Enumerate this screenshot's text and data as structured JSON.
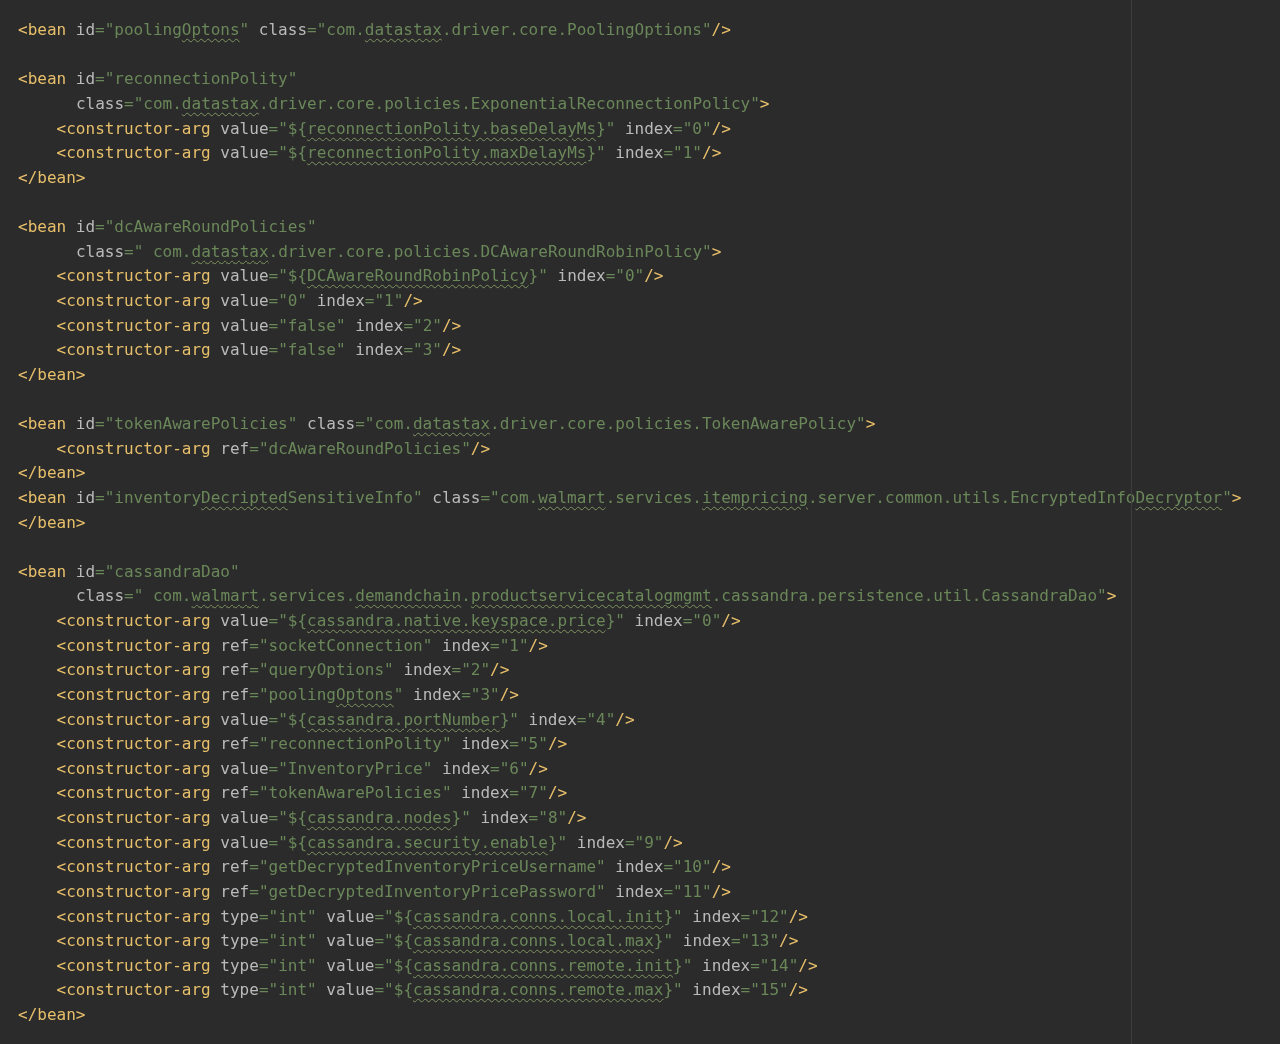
{
  "editor": {
    "lines": [
      {
        "kind": "tag",
        "tokens": [
          {
            "kind": "tag",
            "text": "<bean"
          },
          {
            "kind": "attr",
            "text": " id"
          },
          {
            "kind": "str",
            "text": "=\"pooling"
          },
          {
            "kind": "typo",
            "text": "Optons"
          },
          {
            "kind": "str",
            "text": "\""
          },
          {
            "kind": "attr",
            "text": " class"
          },
          {
            "kind": "str",
            "text": "=\"com."
          },
          {
            "kind": "typo",
            "text": "datastax"
          },
          {
            "kind": "str",
            "text": ".driver.core.PoolingOptions\""
          },
          {
            "kind": "tag",
            "text": "/>"
          }
        ]
      },
      {
        "kind": "blank"
      },
      {
        "kind": "tag",
        "tokens": [
          {
            "kind": "tag",
            "text": "<bean"
          },
          {
            "kind": "attr",
            "text": " id"
          },
          {
            "kind": "str",
            "text": "=\"reconnectionPolity\""
          }
        ]
      },
      {
        "kind": "cont",
        "tokens": [
          {
            "kind": "attr",
            "text": "class"
          },
          {
            "kind": "str",
            "text": "=\"com."
          },
          {
            "kind": "typo",
            "text": "datastax"
          },
          {
            "kind": "str",
            "text": ".driver.core.policies.ExponentialReconnectionPolicy\""
          },
          {
            "kind": "tag",
            "text": ">"
          }
        ]
      },
      {
        "kind": "arg",
        "tokens": [
          {
            "kind": "tag",
            "text": "<constructor-arg"
          },
          {
            "kind": "attr",
            "text": " value"
          },
          {
            "kind": "str",
            "text": "=\"${"
          },
          {
            "kind": "typo",
            "text": "reconnectionPolity.baseDelayMs"
          },
          {
            "kind": "str",
            "text": "}\""
          },
          {
            "kind": "attr",
            "text": " index"
          },
          {
            "kind": "str",
            "text": "=\"0\""
          },
          {
            "kind": "tag",
            "text": "/>"
          }
        ]
      },
      {
        "kind": "arg",
        "tokens": [
          {
            "kind": "tag",
            "text": "<constructor-arg"
          },
          {
            "kind": "attr",
            "text": " value"
          },
          {
            "kind": "str",
            "text": "=\"${"
          },
          {
            "kind": "typo",
            "text": "reconnectionPolity.maxDelayMs"
          },
          {
            "kind": "str",
            "text": "}\""
          },
          {
            "kind": "attr",
            "text": " index"
          },
          {
            "kind": "str",
            "text": "=\"1\""
          },
          {
            "kind": "tag",
            "text": "/>"
          }
        ]
      },
      {
        "kind": "tag",
        "tokens": [
          {
            "kind": "tag",
            "text": "</bean>"
          }
        ]
      },
      {
        "kind": "blank"
      },
      {
        "kind": "tag",
        "tokens": [
          {
            "kind": "tag",
            "text": "<bean"
          },
          {
            "kind": "attr",
            "text": " id"
          },
          {
            "kind": "str",
            "text": "=\"dcAwareRoundPolicies\""
          }
        ]
      },
      {
        "kind": "cont",
        "tokens": [
          {
            "kind": "attr",
            "text": "class"
          },
          {
            "kind": "str",
            "text": "=\" com."
          },
          {
            "kind": "typo",
            "text": "datastax"
          },
          {
            "kind": "str",
            "text": ".driver.core.policies.DCAwareRoundRobinPolicy\""
          },
          {
            "kind": "tag",
            "text": ">"
          }
        ]
      },
      {
        "kind": "arg",
        "tokens": [
          {
            "kind": "tag",
            "text": "<constructor-arg"
          },
          {
            "kind": "attr",
            "text": " value"
          },
          {
            "kind": "str",
            "text": "=\"${"
          },
          {
            "kind": "typo",
            "text": "DCAwareRoundRobinPolicy"
          },
          {
            "kind": "str",
            "text": "}\""
          },
          {
            "kind": "attr",
            "text": " index"
          },
          {
            "kind": "str",
            "text": "=\"0\""
          },
          {
            "kind": "tag",
            "text": "/>"
          }
        ]
      },
      {
        "kind": "arg",
        "tokens": [
          {
            "kind": "tag",
            "text": "<constructor-arg"
          },
          {
            "kind": "attr",
            "text": " value"
          },
          {
            "kind": "str",
            "text": "=\"0\""
          },
          {
            "kind": "attr",
            "text": " index"
          },
          {
            "kind": "str",
            "text": "=\"1\""
          },
          {
            "kind": "tag",
            "text": "/>"
          }
        ]
      },
      {
        "kind": "arg",
        "tokens": [
          {
            "kind": "tag",
            "text": "<constructor-arg"
          },
          {
            "kind": "attr",
            "text": " value"
          },
          {
            "kind": "str",
            "text": "=\"false\""
          },
          {
            "kind": "attr",
            "text": " index"
          },
          {
            "kind": "str",
            "text": "=\"2\""
          },
          {
            "kind": "tag",
            "text": "/>"
          }
        ]
      },
      {
        "kind": "arg",
        "tokens": [
          {
            "kind": "tag",
            "text": "<constructor-arg"
          },
          {
            "kind": "attr",
            "text": " value"
          },
          {
            "kind": "str",
            "text": "=\"false\""
          },
          {
            "kind": "attr",
            "text": " index"
          },
          {
            "kind": "str",
            "text": "=\"3\""
          },
          {
            "kind": "tag",
            "text": "/>"
          }
        ]
      },
      {
        "kind": "tag",
        "tokens": [
          {
            "kind": "tag",
            "text": "</bean>"
          }
        ]
      },
      {
        "kind": "blank"
      },
      {
        "kind": "tag",
        "tokens": [
          {
            "kind": "tag",
            "text": "<bean"
          },
          {
            "kind": "attr",
            "text": " id"
          },
          {
            "kind": "str",
            "text": "=\"tokenAwarePolicies\""
          },
          {
            "kind": "attr",
            "text": " class"
          },
          {
            "kind": "str",
            "text": "=\"com."
          },
          {
            "kind": "typo",
            "text": "datastax"
          },
          {
            "kind": "str",
            "text": ".driver.core.policies.TokenAwarePolicy\""
          },
          {
            "kind": "tag",
            "text": ">"
          }
        ]
      },
      {
        "kind": "arg",
        "tokens": [
          {
            "kind": "tag",
            "text": "<constructor-arg"
          },
          {
            "kind": "attr",
            "text": " ref"
          },
          {
            "kind": "str",
            "text": "=\"dcAwareRoundPolicies\""
          },
          {
            "kind": "tag",
            "text": "/>"
          }
        ]
      },
      {
        "kind": "tag",
        "tokens": [
          {
            "kind": "tag",
            "text": "</bean>"
          }
        ]
      },
      {
        "kind": "tag",
        "tokens": [
          {
            "kind": "tag",
            "text": "<bean"
          },
          {
            "kind": "attr",
            "text": " id"
          },
          {
            "kind": "str",
            "text": "=\"inventory"
          },
          {
            "kind": "typo",
            "text": "Decripted"
          },
          {
            "kind": "str",
            "text": "SensitiveInfo\""
          },
          {
            "kind": "attr",
            "text": " class"
          },
          {
            "kind": "str",
            "text": "=\"com."
          },
          {
            "kind": "typo",
            "text": "walmart"
          },
          {
            "kind": "str",
            "text": ".services."
          },
          {
            "kind": "typo",
            "text": "itempricing"
          },
          {
            "kind": "str",
            "text": ".server.common.utils.EncryptedInfo"
          },
          {
            "kind": "typo",
            "text": "Decryptor"
          },
          {
            "kind": "str",
            "text": "\""
          },
          {
            "kind": "tag",
            "text": ">"
          }
        ]
      },
      {
        "kind": "tag",
        "tokens": [
          {
            "kind": "tag",
            "text": "</bean>"
          }
        ]
      },
      {
        "kind": "blank"
      },
      {
        "kind": "tag",
        "tokens": [
          {
            "kind": "tag",
            "text": "<bean"
          },
          {
            "kind": "attr",
            "text": " id"
          },
          {
            "kind": "str",
            "text": "=\"cassandraDao\""
          }
        ]
      },
      {
        "kind": "cont",
        "tokens": [
          {
            "kind": "attr",
            "text": "class"
          },
          {
            "kind": "str",
            "text": "=\" com."
          },
          {
            "kind": "typo",
            "text": "walmart"
          },
          {
            "kind": "str",
            "text": ".services."
          },
          {
            "kind": "typo",
            "text": "demandchain"
          },
          {
            "kind": "str",
            "text": "."
          },
          {
            "kind": "typo",
            "text": "productservicecatalogmgmt"
          },
          {
            "kind": "str",
            "text": ".cassandra.persistence.util.CassandraDao\""
          },
          {
            "kind": "tag",
            "text": ">"
          }
        ]
      },
      {
        "kind": "arg",
        "tokens": [
          {
            "kind": "tag",
            "text": "<constructor-arg"
          },
          {
            "kind": "attr",
            "text": " value"
          },
          {
            "kind": "str",
            "text": "=\"${"
          },
          {
            "kind": "typo",
            "text": "cassandra.native.keyspace.price"
          },
          {
            "kind": "str",
            "text": "}\""
          },
          {
            "kind": "attr",
            "text": " index"
          },
          {
            "kind": "str",
            "text": "=\"0\""
          },
          {
            "kind": "tag",
            "text": "/>"
          }
        ]
      },
      {
        "kind": "arg",
        "tokens": [
          {
            "kind": "tag",
            "text": "<constructor-arg"
          },
          {
            "kind": "attr",
            "text": " ref"
          },
          {
            "kind": "str",
            "text": "=\"socketConnection\""
          },
          {
            "kind": "attr",
            "text": " index"
          },
          {
            "kind": "str",
            "text": "=\"1\""
          },
          {
            "kind": "tag",
            "text": "/>"
          }
        ]
      },
      {
        "kind": "arg",
        "tokens": [
          {
            "kind": "tag",
            "text": "<constructor-arg"
          },
          {
            "kind": "attr",
            "text": " ref"
          },
          {
            "kind": "str",
            "text": "=\"queryOptions\""
          },
          {
            "kind": "attr",
            "text": " index"
          },
          {
            "kind": "str",
            "text": "=\"2\""
          },
          {
            "kind": "tag",
            "text": "/>"
          }
        ]
      },
      {
        "kind": "arg",
        "tokens": [
          {
            "kind": "tag",
            "text": "<constructor-arg"
          },
          {
            "kind": "attr",
            "text": " ref"
          },
          {
            "kind": "str",
            "text": "=\"pooling"
          },
          {
            "kind": "typo",
            "text": "Optons"
          },
          {
            "kind": "str",
            "text": "\""
          },
          {
            "kind": "attr",
            "text": " index"
          },
          {
            "kind": "str",
            "text": "=\"3\""
          },
          {
            "kind": "tag",
            "text": "/>"
          }
        ]
      },
      {
        "kind": "arg",
        "tokens": [
          {
            "kind": "tag",
            "text": "<constructor-arg"
          },
          {
            "kind": "attr",
            "text": " value"
          },
          {
            "kind": "str",
            "text": "=\"${"
          },
          {
            "kind": "typo",
            "text": "cassandra.portNumber"
          },
          {
            "kind": "str",
            "text": "}\""
          },
          {
            "kind": "attr",
            "text": " index"
          },
          {
            "kind": "str",
            "text": "=\"4\""
          },
          {
            "kind": "tag",
            "text": "/>"
          }
        ]
      },
      {
        "kind": "arg",
        "tokens": [
          {
            "kind": "tag",
            "text": "<constructor-arg"
          },
          {
            "kind": "attr",
            "text": " ref"
          },
          {
            "kind": "str",
            "text": "=\"reconnectionPolity\""
          },
          {
            "kind": "attr",
            "text": " index"
          },
          {
            "kind": "str",
            "text": "=\"5\""
          },
          {
            "kind": "tag",
            "text": "/>"
          }
        ]
      },
      {
        "kind": "arg",
        "tokens": [
          {
            "kind": "tag",
            "text": "<constructor-arg"
          },
          {
            "kind": "attr",
            "text": " value"
          },
          {
            "kind": "str",
            "text": "=\"InventoryPrice\""
          },
          {
            "kind": "attr",
            "text": " index"
          },
          {
            "kind": "str",
            "text": "=\"6\""
          },
          {
            "kind": "tag",
            "text": "/>"
          }
        ]
      },
      {
        "kind": "arg",
        "tokens": [
          {
            "kind": "tag",
            "text": "<constructor-arg"
          },
          {
            "kind": "attr",
            "text": " ref"
          },
          {
            "kind": "str",
            "text": "=\"tokenAwarePolicies\""
          },
          {
            "kind": "attr",
            "text": " index"
          },
          {
            "kind": "str",
            "text": "=\"7\""
          },
          {
            "kind": "tag",
            "text": "/>"
          }
        ]
      },
      {
        "kind": "arg",
        "tokens": [
          {
            "kind": "tag",
            "text": "<constructor-arg"
          },
          {
            "kind": "attr",
            "text": " value"
          },
          {
            "kind": "str",
            "text": "=\"${"
          },
          {
            "kind": "typo",
            "text": "cassandra.nodes"
          },
          {
            "kind": "str",
            "text": "}\""
          },
          {
            "kind": "attr",
            "text": " index"
          },
          {
            "kind": "str",
            "text": "=\"8\""
          },
          {
            "kind": "tag",
            "text": "/>"
          }
        ]
      },
      {
        "kind": "arg",
        "tokens": [
          {
            "kind": "tag",
            "text": "<constructor-arg"
          },
          {
            "kind": "attr",
            "text": " value"
          },
          {
            "kind": "str",
            "text": "=\"${"
          },
          {
            "kind": "typo",
            "text": "cassandra.security.enable"
          },
          {
            "kind": "str",
            "text": "}\""
          },
          {
            "kind": "attr",
            "text": " index"
          },
          {
            "kind": "str",
            "text": "=\"9\""
          },
          {
            "kind": "tag",
            "text": "/>"
          }
        ]
      },
      {
        "kind": "arg",
        "tokens": [
          {
            "kind": "tag",
            "text": "<constructor-arg"
          },
          {
            "kind": "attr",
            "text": " ref"
          },
          {
            "kind": "str",
            "text": "=\"getDecryptedInventoryPriceUsername\""
          },
          {
            "kind": "attr",
            "text": " index"
          },
          {
            "kind": "str",
            "text": "=\"10\""
          },
          {
            "kind": "tag",
            "text": "/>"
          }
        ]
      },
      {
        "kind": "arg",
        "tokens": [
          {
            "kind": "tag",
            "text": "<constructor-arg"
          },
          {
            "kind": "attr",
            "text": " ref"
          },
          {
            "kind": "str",
            "text": "=\"getDecryptedInventoryPricePassword\""
          },
          {
            "kind": "attr",
            "text": " index"
          },
          {
            "kind": "str",
            "text": "=\"11\""
          },
          {
            "kind": "tag",
            "text": "/>"
          }
        ]
      },
      {
        "kind": "arg",
        "tokens": [
          {
            "kind": "tag",
            "text": "<constructor-arg"
          },
          {
            "kind": "attr",
            "text": " type"
          },
          {
            "kind": "str",
            "text": "=\"int\""
          },
          {
            "kind": "attr",
            "text": " value"
          },
          {
            "kind": "str",
            "text": "=\"${"
          },
          {
            "kind": "typo",
            "text": "cassandra.conns.local.init"
          },
          {
            "kind": "str",
            "text": "}\""
          },
          {
            "kind": "attr",
            "text": " index"
          },
          {
            "kind": "str",
            "text": "=\"12\""
          },
          {
            "kind": "tag",
            "text": "/>"
          }
        ]
      },
      {
        "kind": "arg",
        "tokens": [
          {
            "kind": "tag",
            "text": "<constructor-arg"
          },
          {
            "kind": "attr",
            "text": " type"
          },
          {
            "kind": "str",
            "text": "=\"int\""
          },
          {
            "kind": "attr",
            "text": " value"
          },
          {
            "kind": "str",
            "text": "=\"${"
          },
          {
            "kind": "typo",
            "text": "cassandra.conns.local.max"
          },
          {
            "kind": "str",
            "text": "}\""
          },
          {
            "kind": "attr",
            "text": " index"
          },
          {
            "kind": "str",
            "text": "=\"13\""
          },
          {
            "kind": "tag",
            "text": "/>"
          }
        ]
      },
      {
        "kind": "arg",
        "tokens": [
          {
            "kind": "tag",
            "text": "<constructor-arg"
          },
          {
            "kind": "attr",
            "text": " type"
          },
          {
            "kind": "str",
            "text": "=\"int\""
          },
          {
            "kind": "attr",
            "text": " value"
          },
          {
            "kind": "str",
            "text": "=\"${"
          },
          {
            "kind": "typo",
            "text": "cassandra.conns.remote.init"
          },
          {
            "kind": "str",
            "text": "}\""
          },
          {
            "kind": "attr",
            "text": " index"
          },
          {
            "kind": "str",
            "text": "=\"14\""
          },
          {
            "kind": "tag",
            "text": "/>"
          }
        ]
      },
      {
        "kind": "arg",
        "tokens": [
          {
            "kind": "tag",
            "text": "<constructor-arg"
          },
          {
            "kind": "attr",
            "text": " type"
          },
          {
            "kind": "str",
            "text": "=\"int\""
          },
          {
            "kind": "attr",
            "text": " value"
          },
          {
            "kind": "str",
            "text": "=\"${"
          },
          {
            "kind": "typo",
            "text": "cassandra.conns.remote.max"
          },
          {
            "kind": "str",
            "text": "}\""
          },
          {
            "kind": "attr",
            "text": " index"
          },
          {
            "kind": "str",
            "text": "=\"15\""
          },
          {
            "kind": "tag",
            "text": "/>"
          }
        ]
      },
      {
        "kind": "tag",
        "tokens": [
          {
            "kind": "tag",
            "text": "</bean>"
          }
        ]
      }
    ]
  }
}
